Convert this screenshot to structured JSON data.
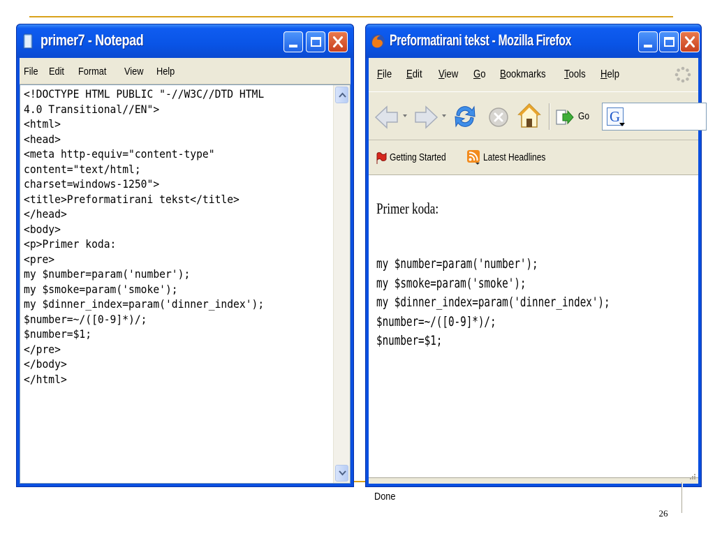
{
  "slide": {
    "page_number": "26",
    "accent": "#d9a21b"
  },
  "notepad": {
    "title": "primer7 - Notepad",
    "menu": [
      "File",
      "Edit",
      "Format",
      "View",
      "Help"
    ],
    "lines": [
      "<!DOCTYPE HTML PUBLIC \"-//W3C//DTD HTML",
      "4.0 Transitional//EN\">",
      "<html>",
      "<head>",
      "<meta http-equiv=\"content-type\"",
      "content=\"text/html;",
      "charset=windows-1250\">",
      "<title>Preformatirani tekst</title>",
      "</head>",
      "<body>",
      "<p>Primer koda:",
      "<pre>",
      "my $number=param('number');",
      "my $smoke=param('smoke');",
      "my $dinner_index=param('dinner_index');",
      "$number=~/([0-9]*)/;",
      "$number=$1;",
      "</pre>",
      "</body>",
      "</html>"
    ],
    "icons": {
      "app": "notepad-icon",
      "scroll_up": "scroll-up-arrow-icon",
      "scroll_down": "scroll-down-arrow-icon"
    }
  },
  "firefox": {
    "title": "Preformatirani tekst - Mozilla Firefox",
    "menu": [
      {
        "accel": "F",
        "rest": "ile"
      },
      {
        "accel": "E",
        "rest": "dit"
      },
      {
        "accel": "V",
        "rest": "iew"
      },
      {
        "accel": "G",
        "rest": "o"
      },
      {
        "accel": "B",
        "rest": "ookmarks"
      },
      {
        "accel": "T",
        "rest": "ools"
      },
      {
        "accel": "H",
        "rest": "elp"
      }
    ],
    "go_label": "Go",
    "address_glyph": "G",
    "bookmarks": [
      "Getting Started",
      "Latest Headlines"
    ],
    "content": {
      "paragraph": "Primer koda:",
      "pre_lines": [
        "my $number=param('number');",
        "my $smoke=param('smoke');",
        "my $dinner_index=param('dinner_index');",
        "$number=~/([0-9]*)/;",
        "$number=$1;"
      ]
    },
    "status": "Done",
    "icons": {
      "app": "firefox-icon",
      "back": "back-arrow-icon",
      "forward": "forward-arrow-icon",
      "reload": "reload-icon",
      "stop": "stop-icon",
      "home": "home-icon",
      "go": "go-arrow-icon",
      "throbber": "throbber-icon",
      "getting_started": "getting-started-icon",
      "rss": "rss-feed-icon"
    }
  },
  "colors": {
    "xp_blue": "#0a4fe0",
    "close_red": "#c8411f",
    "window_face": "#ece9d8"
  }
}
